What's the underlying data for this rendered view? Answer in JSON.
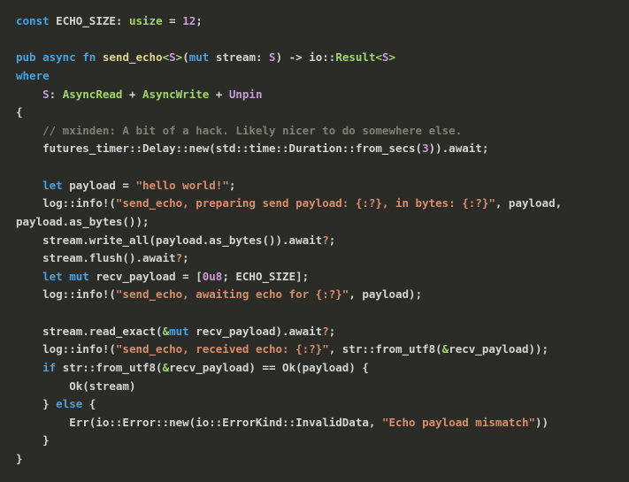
{
  "code": {
    "l1_kw1": "const",
    "l1_name": " ECHO_SIZE",
    "l1_colon": ": ",
    "l1_ty": "usize",
    "l1_eq": " = ",
    "l1_num": "12",
    "l1_semi": ";",
    "l3_kw1": "pub",
    "l3_sp1": " ",
    "l3_kw2": "async",
    "l3_sp2": " ",
    "l3_kw3": "fn",
    "l3_sp3": " ",
    "l3_fn": "send_echo",
    "l3_lt": "<",
    "l3_gen": "S",
    "l3_gt": ">",
    "l3_op": "(",
    "l3_mut": "mut",
    "l3_arg": " stream: ",
    "l3_gen2": "S",
    "l3_cp": ") -> io::",
    "l3_res": "Result",
    "l3_lt2": "<",
    "l3_gen3": "S",
    "l3_gt2": ">",
    "l4_where": "where",
    "l5_ind": "    ",
    "l5_gen": "S",
    "l5_colon": ": ",
    "l5_t1": "AsyncRead",
    "l5_plus1": " + ",
    "l5_t2": "AsyncWrite",
    "l5_plus2": " + ",
    "l5_t3": "Unpin",
    "l6_brace": "{",
    "l7_ind": "    ",
    "l7_comment": "// mxinden: A bit of a hack. Likely nicer to do somewhere else.",
    "l8_ind": "    ",
    "l8_a": "futures_timer::Delay::new(std::time::Duration::from_secs(",
    "l8_num": "3",
    "l8_b": ")).await;",
    "l10_ind": "    ",
    "l10_let": "let",
    "l10_a": " payload = ",
    "l10_str": "\"hello world!\"",
    "l10_semi": ";",
    "l11_ind": "    ",
    "l11_a": "log::info!(",
    "l11_str": "\"send_echo, preparing send payload: {:?}, in bytes: {:?}\"",
    "l11_b": ", payload, payload.as_bytes());",
    "l12_ind": "    ",
    "l12_a": "stream.write_all(payload.as_bytes()).await",
    "l12_q": "?",
    "l12_semi": ";",
    "l13_ind": "    ",
    "l13_a": "stream.flush().await",
    "l13_q": "?",
    "l13_semi": ";",
    "l14_ind": "    ",
    "l14_let": "let",
    "l14_sp": " ",
    "l14_mut": "mut",
    "l14_a": " recv_payload = [",
    "l14_num": "0u8",
    "l14_b": "; ECHO_SIZE];",
    "l15_ind": "    ",
    "l15_a": "log::info!(",
    "l15_str": "\"send_echo, awaiting echo for {:?}\"",
    "l15_b": ", payload);",
    "l17_ind": "    ",
    "l17_a": "stream.read_exact(",
    "l17_amp": "&",
    "l17_mut": "mut",
    "l17_b": " recv_payload).await",
    "l17_q": "?",
    "l17_semi": ";",
    "l18_ind": "    ",
    "l18_a": "log::info!(",
    "l18_str": "\"send_echo, received echo: {:?}\"",
    "l18_b": ", str::from_utf8(",
    "l18_amp": "&",
    "l18_c": "recv_payload));",
    "l19_ind": "    ",
    "l19_if": "if",
    "l19_a": " str::from_utf8(",
    "l19_amp": "&",
    "l19_b": "recv_payload) == Ok(payload) {",
    "l20_ind": "        ",
    "l20_a": "Ok(stream)",
    "l21_ind": "    ",
    "l21_a": "} ",
    "l21_else": "else",
    "l21_b": " {",
    "l22_ind": "        ",
    "l22_a": "Err(io::Error::new(io::ErrorKind::InvalidData, ",
    "l22_str": "\"Echo payload mismatch\"",
    "l22_b": "))",
    "l23_ind": "    ",
    "l23_a": "}",
    "l24_a": "}"
  }
}
